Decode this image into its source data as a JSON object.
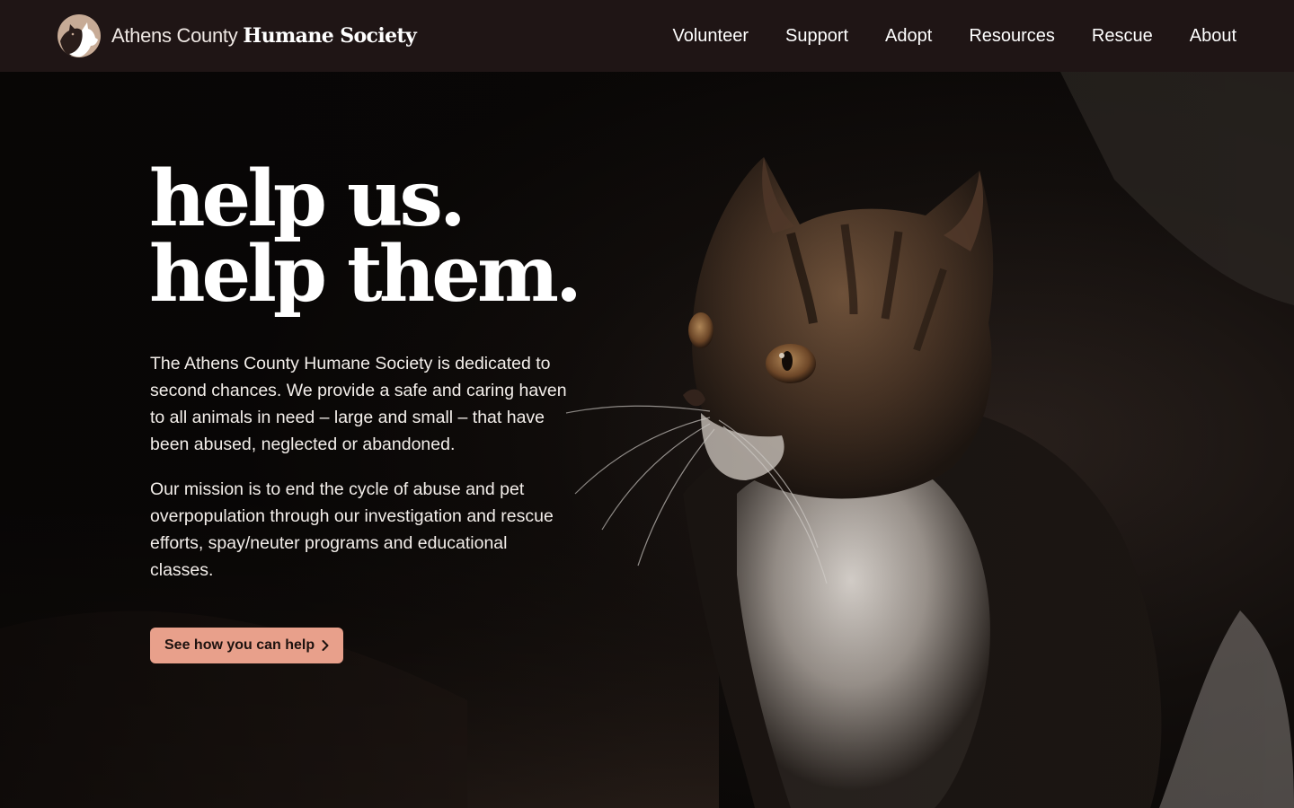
{
  "header": {
    "logo_light": "Athens County",
    "logo_bold": "Humane Society",
    "logo_icon": "cat-and-dog-silhouette-icon",
    "nav": [
      "Volunteer",
      "Support",
      "Adopt",
      "Resources",
      "Rescue",
      "About"
    ]
  },
  "hero": {
    "headline_line1": "help us.",
    "headline_line2": "help them.",
    "paragraph1": "The Athens County Humane Society is dedicated to second chances. We provide a safe and caring haven to all animals in need – large and small – that have been abused, neglected or abandoned.",
    "paragraph2": "Our mission is to end the cycle of abuse and pet overpopulation through our investigation and rescue efforts, spay/neuter programs and educational classes.",
    "cta_label": "See how you can help",
    "cta_icon": "chevron-right-icon",
    "photo": "tabby-kitten-photo"
  },
  "colors": {
    "header_bg": "#1f1515",
    "accent": "#e8a08b",
    "logo_circle": "#c7ab96"
  }
}
